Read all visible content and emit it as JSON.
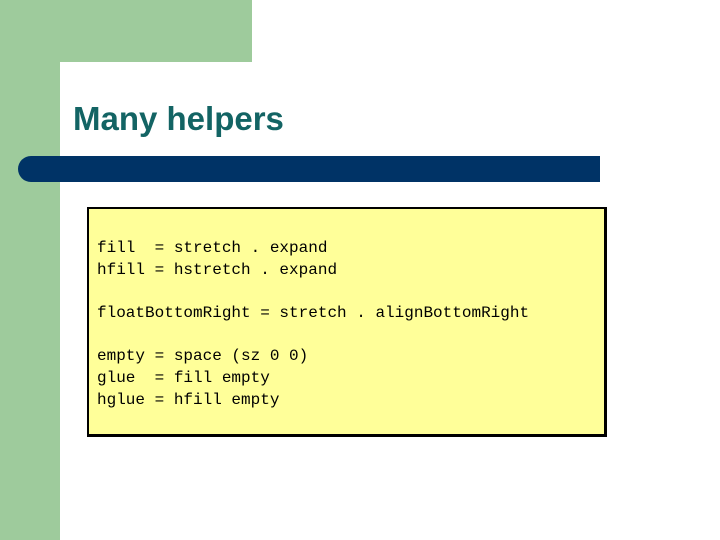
{
  "slide": {
    "title": "Many helpers",
    "colors": {
      "green_accent": "#9ecb9c",
      "title_text": "#136464",
      "title_bar": "#003366",
      "code_background": "#ffff99"
    },
    "code_lines": [
      "fill  = stretch . expand",
      "hfill = hstretch . expand",
      "",
      "floatBottomRight = stretch . alignBottomRight",
      "",
      "empty = space (sz 0 0)",
      "glue  = fill empty",
      "hglue = hfill empty"
    ]
  }
}
